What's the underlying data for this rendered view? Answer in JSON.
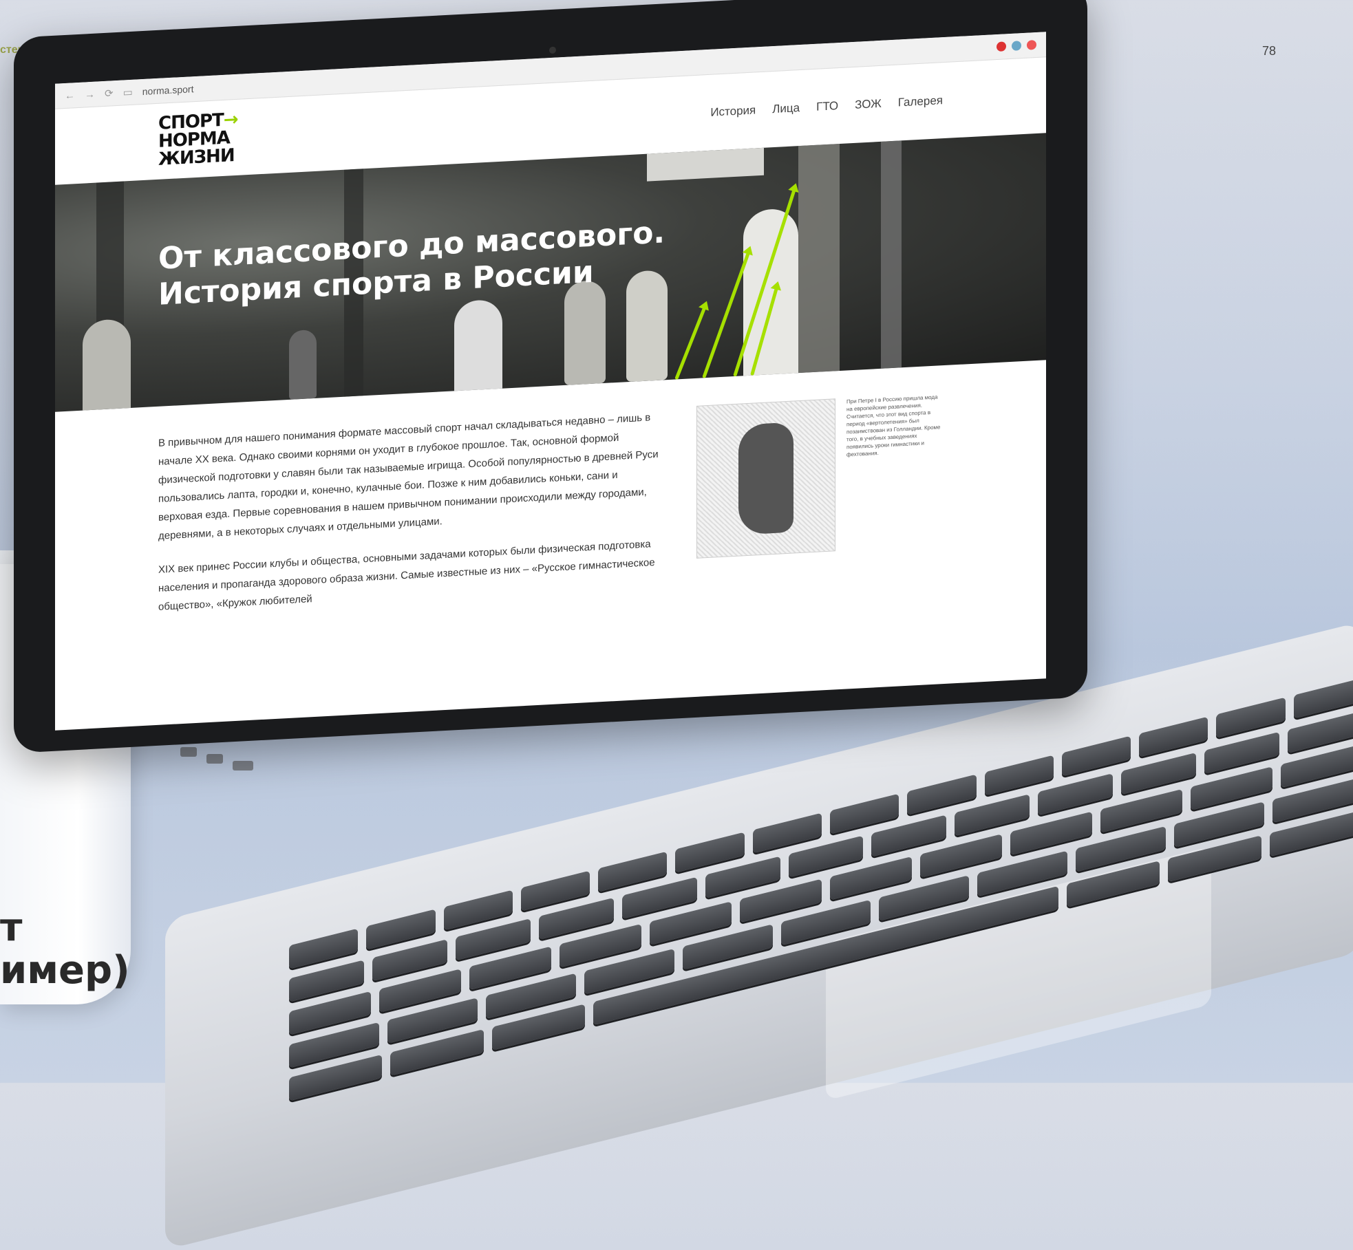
{
  "page": {
    "corner_label": "стер-бренда",
    "page_number": "78",
    "side_label_line1": "т",
    "side_label_line2": "имер)"
  },
  "browser": {
    "url": "norma.sport",
    "icons": [
      "back-arrow-icon",
      "forward-arrow-icon",
      "reload-icon",
      "page-icon"
    ]
  },
  "site": {
    "logo_line1": "СПОРТ",
    "logo_arrow": "→",
    "logo_line2": "НОРМА",
    "logo_line3": "ЖИЗНИ",
    "menu": [
      "История",
      "Лица",
      "ГТО",
      "ЗОЖ",
      "Галерея"
    ]
  },
  "hero": {
    "title_line1": "От классового до массового.",
    "title_line2": "История спорта в России",
    "accent_color": "#a6e000"
  },
  "article": {
    "paragraph1": "В привычном для нашего понимания формате массовый спорт начал складываться недавно – лишь в начале XX века. Однако своими корнями он уходит в глубокое прошлое. Так, основной формой физической подготовки у славян были так называемые игрища. Особой популярностью в древней Руси пользовались лапта, городки и, конечно, кулачные бои. Позже к ним добавились коньки, сани и верховая езда. Первые соревнования в нашем привычном понимании происходили между городами, деревнями, а в некоторых случаях и отдельными улицами.",
    "paragraph2": "XIX век принес России клубы и общества, основными задачами которых были физическая подготовка населения и пропаганда здорового образа жизни. Самые известные из них – «Русское гимнастическое общество», «Кружок любителей",
    "caption": "При Петре I в Россию пришла мода на европейские развлечения. Считается, что этот вид спорта в период «вертолетения» был позаимствован из Голландии. Кроме того, в учебных заведениях появились уроки гимнастики и фехтования."
  }
}
